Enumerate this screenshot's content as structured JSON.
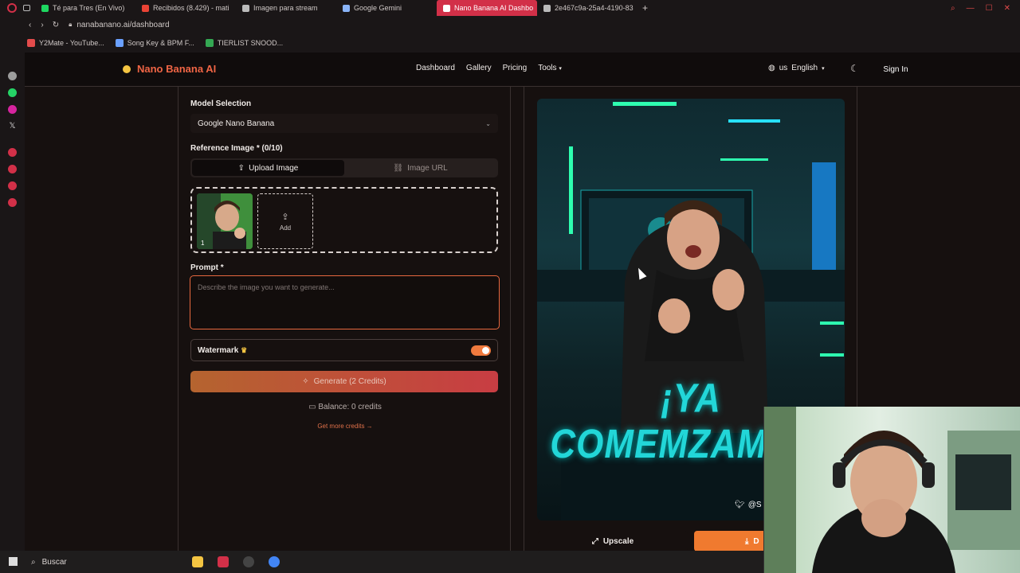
{
  "browser": {
    "tabs": [
      {
        "label": "Té para Tres (En Vivo)",
        "active": false,
        "color": "#1ed760"
      },
      {
        "label": "Recibidos (8.429) - mati",
        "active": false,
        "color": "#ea4335"
      },
      {
        "label": "Imagen para stream",
        "active": false,
        "color": "#bbbbbb"
      },
      {
        "label": "Google Gemini",
        "active": false,
        "color": "#8ab4f8"
      },
      {
        "label": "Nano Banana AI Dashbo",
        "active": true,
        "color": "#ffffff"
      },
      {
        "label": "2e467c9a-25a4-4190-83",
        "active": false,
        "color": "#bbbbbb"
      }
    ],
    "url": "nanabanano.ai/dashboard",
    "bookmarks": [
      {
        "label": "Y2Mate - YouTube...",
        "color": "#e34b4b"
      },
      {
        "label": "Song Key & BPM F...",
        "color": "#6aa0ff"
      },
      {
        "label": "TIERLIST SNOOD...",
        "color": "#34a853"
      }
    ]
  },
  "nav": {
    "brand": "Nano Banana AI",
    "links": [
      "Dashboard",
      "Gallery",
      "Pricing",
      "Tools"
    ],
    "lang_code": "us",
    "lang_label": "English",
    "sign_in": "Sign In"
  },
  "form": {
    "model_label": "Model Selection",
    "model_value": "Google Nano Banana",
    "ref_label": "Reference Image * (0/10)",
    "upload_tab": "Upload Image",
    "url_tab": "Image URL",
    "thumb_index": "1",
    "add_label": "Add",
    "prompt_label": "Prompt *",
    "prompt_placeholder": "Describe the image you want to generate...",
    "watermark_label": "Watermark",
    "watermark_on": true,
    "generate_label": "Generate (2 Credits)",
    "balance": "Balance: 0 credits",
    "more_credits": "Get more credits →"
  },
  "preview": {
    "caption": "¡YA COMEMZAMOS!",
    "handle": "@S",
    "upscale_label": "Upscale",
    "download_label": "D"
  },
  "taskbar": {
    "search_label": "Buscar"
  },
  "colors": {
    "accent": "#f06545",
    "active_tab": "#d23048",
    "caption": "#22d6d8"
  }
}
